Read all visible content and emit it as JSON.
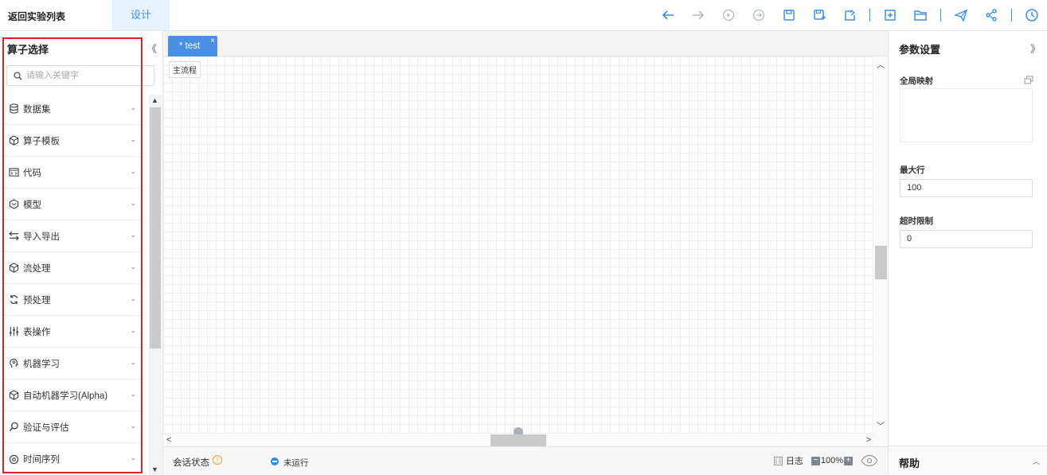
{
  "header": {
    "back_label": "返回实验列表",
    "design_tab": "设计",
    "toolbar_icons": [
      "undo-icon",
      "redo-icon",
      "run-icon",
      "run-to-icon",
      "save-icon",
      "save-as-icon",
      "export-icon",
      "add-icon",
      "open-folder-icon",
      "publish-icon",
      "share-icon",
      "history-icon"
    ]
  },
  "left": {
    "title": "算子选择",
    "collapse": "《",
    "search_placeholder": "请输入关键字",
    "categories": [
      {
        "label": "数据集",
        "icon": "database-icon"
      },
      {
        "label": "算子模板",
        "icon": "cube-icon"
      },
      {
        "label": "代码",
        "icon": "code-icon"
      },
      {
        "label": "模型",
        "icon": "model-icon"
      },
      {
        "label": "导入导出",
        "icon": "transfer-icon"
      },
      {
        "label": "流处理",
        "icon": "cube-icon"
      },
      {
        "label": "预处理",
        "icon": "refresh-icon"
      },
      {
        "label": "表操作",
        "icon": "sliders-icon"
      },
      {
        "label": "机器学习",
        "icon": "brain-icon"
      },
      {
        "label": "自动机器学习(Alpha)",
        "icon": "cube-icon"
      },
      {
        "label": "验证与评估",
        "icon": "search-icon"
      },
      {
        "label": "时间序列",
        "icon": "clock-icon"
      }
    ]
  },
  "canvas": {
    "tab_label": "* test",
    "tab_close": "×",
    "flow_tag": "主流程"
  },
  "status": {
    "session_label": "会话状态",
    "session_value": "未运行",
    "log_label": "日志",
    "zoom": "100%"
  },
  "right": {
    "title": "参数设置",
    "expand": "》",
    "global_map_label": "全局映射",
    "max_rows_label": "最大行",
    "max_rows_value": "100",
    "timeout_label": "超时限制",
    "timeout_value": "0",
    "help_label": "帮助"
  },
  "colors": {
    "accent": "#3b8fe6",
    "tab_blue": "#4a90e2",
    "highlight_red": "#e0202a"
  }
}
